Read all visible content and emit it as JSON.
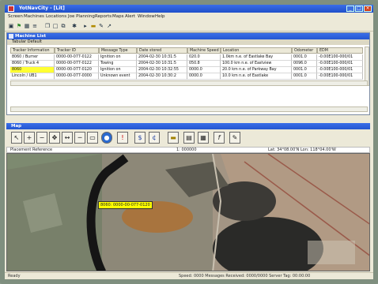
{
  "window": {
    "title": "YotNavCity - [Lit]"
  },
  "menu": [
    "Screen",
    "Machines",
    "Locations",
    "Joe Planning",
    "Reports",
    "Maps",
    "Alert",
    "Window",
    "Help"
  ],
  "machine_list": {
    "title": "Machine List",
    "subbar": "Tabular Default",
    "columns": [
      "Tracker Information",
      "Tracker ID",
      "Message Type",
      "Date stored",
      "Machine Speed",
      "Location",
      "Odometer",
      "EDM"
    ],
    "rows": [
      [
        "8060 / Burner",
        "0000-00-077-0122",
        "Ignition on",
        "2004-02-30 10:31:5",
        "020.0",
        "1.0km n.e. of Eastlake Bay",
        "0001.0",
        "-0.00E100-000/01"
      ],
      [
        "8060 / Truck 4",
        "0000-00-077-0122",
        "Towing",
        "2004-02-30 10:31:5",
        "050.8",
        "100.0 km n.e. of Eastview",
        "0096.0",
        "-0.00E100-000/01"
      ],
      [
        "8060",
        "0000-00-077-0120",
        "Ignition on",
        "2004-02-30 10:32:55",
        "0000.0",
        "20.0 km n.e. of Parkway Bay",
        "0001.0",
        "-0.00E100-000/01"
      ],
      [
        "Lincoln / UB1",
        "0000-00-077-0000",
        "Unknown event",
        "2004-02-30 10:30:2",
        "0000.0",
        "10.0 km n.e. of Eastlake",
        "0001.0",
        "-0.00E100-000/01"
      ]
    ]
  },
  "map_panel": {
    "title": "Map",
    "info_left": "Placement Reference",
    "info_mid": "1: 000000",
    "info_right": "Lat: 34°08.00'N Lon: 118°04.00'W",
    "marker_label": "8060: 0000-00-077-0120"
  },
  "status": {
    "left": "Ready",
    "right": "Speed: 0000    Messages Received: 0000/0000    Server Tag: 00:00:00"
  },
  "colors": {
    "titlebar": "#2457d0",
    "selected_row": "#ffff33",
    "marker": "#ffff00"
  }
}
